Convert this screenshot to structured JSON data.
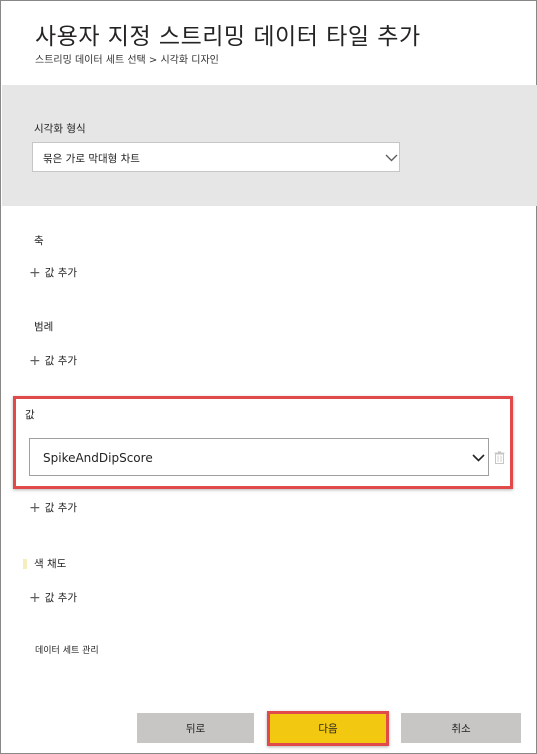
{
  "header": {
    "title": "사용자 지정 스트리밍 데이터 타일 추가",
    "breadcrumb": "스트리밍 데이터 세트 선택 > 시각화 디자인"
  },
  "visualization": {
    "label": "시각화 형식",
    "selected": "묶은 가로 막대형 차트"
  },
  "axis": {
    "label": "축",
    "add_label": "값 추가"
  },
  "legend": {
    "label": "범례",
    "add_label": "값 추가"
  },
  "value": {
    "label": "값",
    "selected": "SpikeAndDipScore",
    "add_label": "값 추가"
  },
  "color_saturation": {
    "label": "색 채도",
    "add_label": "값 추가"
  },
  "manage_dataset_link": "데이터 세트 관리",
  "footer": {
    "back": "뒤로",
    "next": "다음",
    "cancel": "취소"
  },
  "colors": {
    "accent_yellow": "#f2c811",
    "highlight_red": "#e04a4a",
    "panel_grey": "#e6e6e6",
    "button_grey": "#c8c6c4"
  },
  "icons": {
    "dropdown": "chevron-down-icon",
    "add": "plus-icon",
    "delete": "trash-icon"
  }
}
